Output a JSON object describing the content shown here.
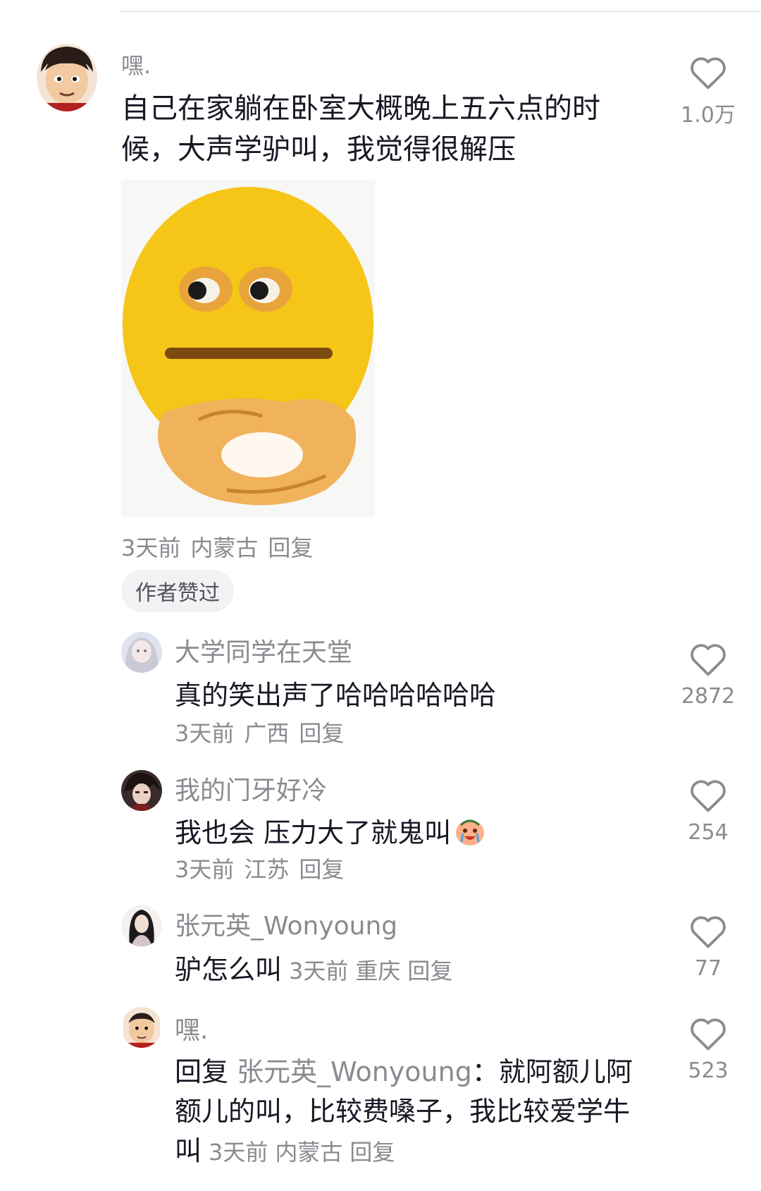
{
  "comments": [
    {
      "name": "嘿.",
      "text": "自己在家躺在卧室大概晚上五六点的时候，大声学驴叫，我觉得很解压",
      "time": "3天前",
      "location": "内蒙古",
      "reply_label": "回复",
      "likes": "1.0万",
      "badge": "作者赞过",
      "avatar_icon": "cartoon-face-avatar",
      "sticker_icon": "yellow-emoji-ok-hand-sticker"
    },
    {
      "name": "大学同学在天堂",
      "text": "真的笑出声了哈哈哈哈哈哈",
      "time": "3天前",
      "location": "广西",
      "reply_label": "回复",
      "likes": "2872"
    },
    {
      "name": "我的门牙好冷",
      "text": "我也会 压力大了就鬼叫",
      "emoji": "crying-emoji",
      "time": "3天前",
      "location": "江苏",
      "reply_label": "回复",
      "likes": "254"
    },
    {
      "name": "张元英_Wonyoung",
      "text": "驴怎么叫",
      "time": "3天前",
      "location": "重庆",
      "reply_label": "回复",
      "likes": "77"
    },
    {
      "name": "嘿.",
      "reply_prefix": "回复",
      "reply_to": "张元英_Wonyoung",
      "colon": "：",
      "text": "就阿额儿阿额儿的叫，比较费嗓子，我比较爱学牛叫",
      "time": "3天前",
      "location": "内蒙古",
      "reply_label": "回复",
      "likes": "523"
    }
  ],
  "colors": {
    "text": "#161823",
    "secondary": "#8a8b91",
    "badge_bg": "#f2f2f4"
  }
}
